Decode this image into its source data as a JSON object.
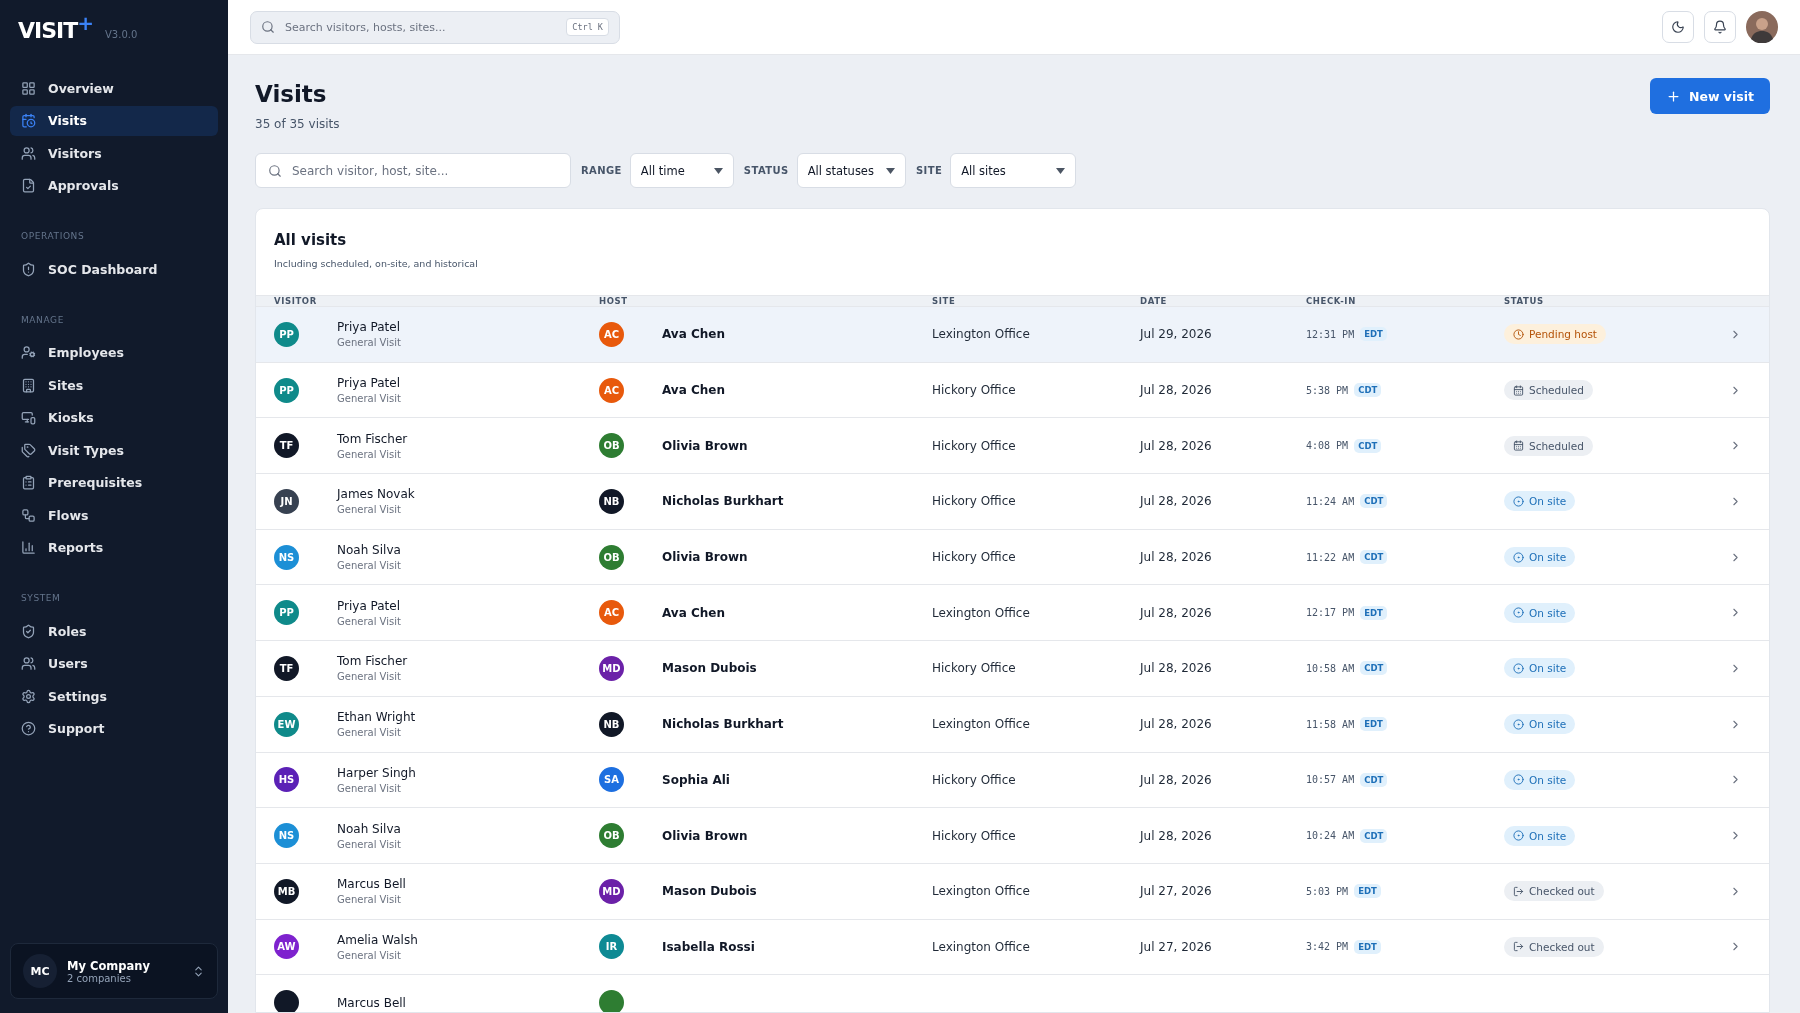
{
  "sidebar": {
    "logo": "VISIT",
    "logo_mark": "+",
    "version": "V3.0.0",
    "sections": [
      {
        "items": [
          {
            "label": "Overview",
            "selected": false
          },
          {
            "label": "Visits",
            "selected": true
          },
          {
            "label": "Visitors",
            "selected": false
          },
          {
            "label": "Approvals",
            "selected": false
          }
        ]
      },
      {
        "title": "OPERATIONS",
        "items": [
          {
            "label": "SOC Dashboard",
            "selected": false
          }
        ]
      },
      {
        "title": "MANAGE",
        "items": [
          {
            "label": "Employees",
            "selected": false
          },
          {
            "label": "Sites",
            "selected": false
          },
          {
            "label": "Kiosks",
            "selected": false
          },
          {
            "label": "Visit Types",
            "selected": false
          },
          {
            "label": "Prerequisites",
            "selected": false
          },
          {
            "label": "Flows",
            "selected": false
          },
          {
            "label": "Reports",
            "selected": false
          }
        ]
      },
      {
        "title": "SYSTEM",
        "items": [
          {
            "label": "Roles",
            "selected": false
          },
          {
            "label": "Users",
            "selected": false
          },
          {
            "label": "Settings",
            "selected": false
          },
          {
            "label": "Support",
            "selected": false
          }
        ]
      }
    ],
    "company": {
      "initials": "MC",
      "name": "My Company",
      "subtitle": "2 companies"
    }
  },
  "topbar": {
    "search": {
      "placeholder": "Search visitors, hosts, sites..."
    },
    "shortcut": "Ctrl K"
  },
  "page": {
    "title": "Visits",
    "subtitle": "35 of 35 visits",
    "new_button": "New visit"
  },
  "filters": {
    "search": {
      "placeholder": "Search visitor, host, site..."
    },
    "selects": [
      {
        "label": "RANGE",
        "value": "All time"
      },
      {
        "label": "STATUS",
        "value": "All statuses"
      },
      {
        "label": "SITE",
        "value": "All sites"
      }
    ]
  },
  "table": {
    "title": "All visits",
    "subtitle": "Including scheduled, on-site, and historical",
    "columns": [
      "VISITOR",
      "HOST",
      "SITE",
      "DATE",
      "CHECK-IN",
      "STATUS"
    ],
    "rows": [
      {
        "selected": true,
        "visitor": {
          "initials": "PP",
          "name": "Priya Patel",
          "type": "General Visit",
          "color": "#0f8a8a"
        },
        "host": {
          "initials": "AC",
          "name": "Ava Chen",
          "color": "#e8590c"
        },
        "site": "Lexington Office",
        "date": "Jul 29, 2026",
        "time": "12:31 PM",
        "tz": "EDT",
        "status": {
          "kind": "pending",
          "label": "Pending host"
        }
      },
      {
        "selected": false,
        "visitor": {
          "initials": "PP",
          "name": "Priya Patel",
          "type": "General Visit",
          "color": "#0f8a8a"
        },
        "host": {
          "initials": "AC",
          "name": "Ava Chen",
          "color": "#e8590c"
        },
        "site": "Hickory Office",
        "date": "Jul 28, 2026",
        "time": "5:38 PM",
        "tz": "CDT",
        "status": {
          "kind": "scheduled",
          "label": "Scheduled"
        }
      },
      {
        "selected": false,
        "visitor": {
          "initials": "TF",
          "name": "Tom Fischer",
          "type": "General Visit",
          "color": "#111827"
        },
        "host": {
          "initials": "OB",
          "name": "Olivia Brown",
          "color": "#2e7d32"
        },
        "site": "Hickory Office",
        "date": "Jul 28, 2026",
        "time": "4:08 PM",
        "tz": "CDT",
        "status": {
          "kind": "scheduled",
          "label": "Scheduled"
        }
      },
      {
        "selected": false,
        "visitor": {
          "initials": "JN",
          "name": "James Novak",
          "type": "General Visit",
          "color": "#374151"
        },
        "host": {
          "initials": "NB",
          "name": "Nicholas Burkhart",
          "color": "#111827"
        },
        "site": "Hickory Office",
        "date": "Jul 28, 2026",
        "time": "11:24 AM",
        "tz": "CDT",
        "status": {
          "kind": "onsite",
          "label": "On site"
        }
      },
      {
        "selected": false,
        "visitor": {
          "initials": "NS",
          "name": "Noah Silva",
          "type": "General Visit",
          "color": "#1c8fd6"
        },
        "host": {
          "initials": "OB",
          "name": "Olivia Brown",
          "color": "#2e7d32"
        },
        "site": "Hickory Office",
        "date": "Jul 28, 2026",
        "time": "11:22 AM",
        "tz": "CDT",
        "status": {
          "kind": "onsite",
          "label": "On site"
        }
      },
      {
        "selected": false,
        "visitor": {
          "initials": "PP",
          "name": "Priya Patel",
          "type": "General Visit",
          "color": "#0f8a8a"
        },
        "host": {
          "initials": "AC",
          "name": "Ava Chen",
          "color": "#e8590c"
        },
        "site": "Lexington Office",
        "date": "Jul 28, 2026",
        "time": "12:17 PM",
        "tz": "EDT",
        "status": {
          "kind": "onsite",
          "label": "On site"
        }
      },
      {
        "selected": false,
        "visitor": {
          "initials": "TF",
          "name": "Tom Fischer",
          "type": "General Visit",
          "color": "#111827"
        },
        "host": {
          "initials": "MD",
          "name": "Mason Dubois",
          "color": "#6b21a8"
        },
        "site": "Hickory Office",
        "date": "Jul 28, 2026",
        "time": "10:58 AM",
        "tz": "CDT",
        "status": {
          "kind": "onsite",
          "label": "On site"
        }
      },
      {
        "selected": false,
        "visitor": {
          "initials": "EW",
          "name": "Ethan Wright",
          "type": "General Visit",
          "color": "#0f8a8a"
        },
        "host": {
          "initials": "NB",
          "name": "Nicholas Burkhart",
          "color": "#111827"
        },
        "site": "Lexington Office",
        "date": "Jul 28, 2026",
        "time": "11:58 AM",
        "tz": "EDT",
        "status": {
          "kind": "onsite",
          "label": "On site"
        }
      },
      {
        "selected": false,
        "visitor": {
          "initials": "HS",
          "name": "Harper Singh",
          "type": "General Visit",
          "color": "#5b21b6"
        },
        "host": {
          "initials": "SA",
          "name": "Sophia Ali",
          "color": "#1d6fe0"
        },
        "site": "Hickory Office",
        "date": "Jul 28, 2026",
        "time": "10:57 AM",
        "tz": "CDT",
        "status": {
          "kind": "onsite",
          "label": "On site"
        }
      },
      {
        "selected": false,
        "visitor": {
          "initials": "NS",
          "name": "Noah Silva",
          "type": "General Visit",
          "color": "#1c8fd6"
        },
        "host": {
          "initials": "OB",
          "name": "Olivia Brown",
          "color": "#2e7d32"
        },
        "site": "Hickory Office",
        "date": "Jul 28, 2026",
        "time": "10:24 AM",
        "tz": "CDT",
        "status": {
          "kind": "onsite",
          "label": "On site"
        }
      },
      {
        "selected": false,
        "visitor": {
          "initials": "MB",
          "name": "Marcus Bell",
          "type": "General Visit",
          "color": "#111827"
        },
        "host": {
          "initials": "MD",
          "name": "Mason Dubois",
          "color": "#6b21a8"
        },
        "site": "Lexington Office",
        "date": "Jul 27, 2026",
        "time": "5:03 PM",
        "tz": "EDT",
        "status": {
          "kind": "checkedout",
          "label": "Checked out"
        }
      },
      {
        "selected": false,
        "visitor": {
          "initials": "AW",
          "name": "Amelia Walsh",
          "type": "General Visit",
          "color": "#7e22ce"
        },
        "host": {
          "initials": "IR",
          "name": "Isabella Rossi",
          "color": "#0e8a94"
        },
        "site": "Lexington Office",
        "date": "Jul 27, 2026",
        "time": "3:42 PM",
        "tz": "EDT",
        "status": {
          "kind": "checkedout",
          "label": "Checked out"
        }
      },
      {
        "selected": false,
        "visitor": {
          "name": "Marcus Bell",
          "color": "#111827"
        },
        "host": {
          "color": "#2e7d32"
        }
      }
    ]
  }
}
